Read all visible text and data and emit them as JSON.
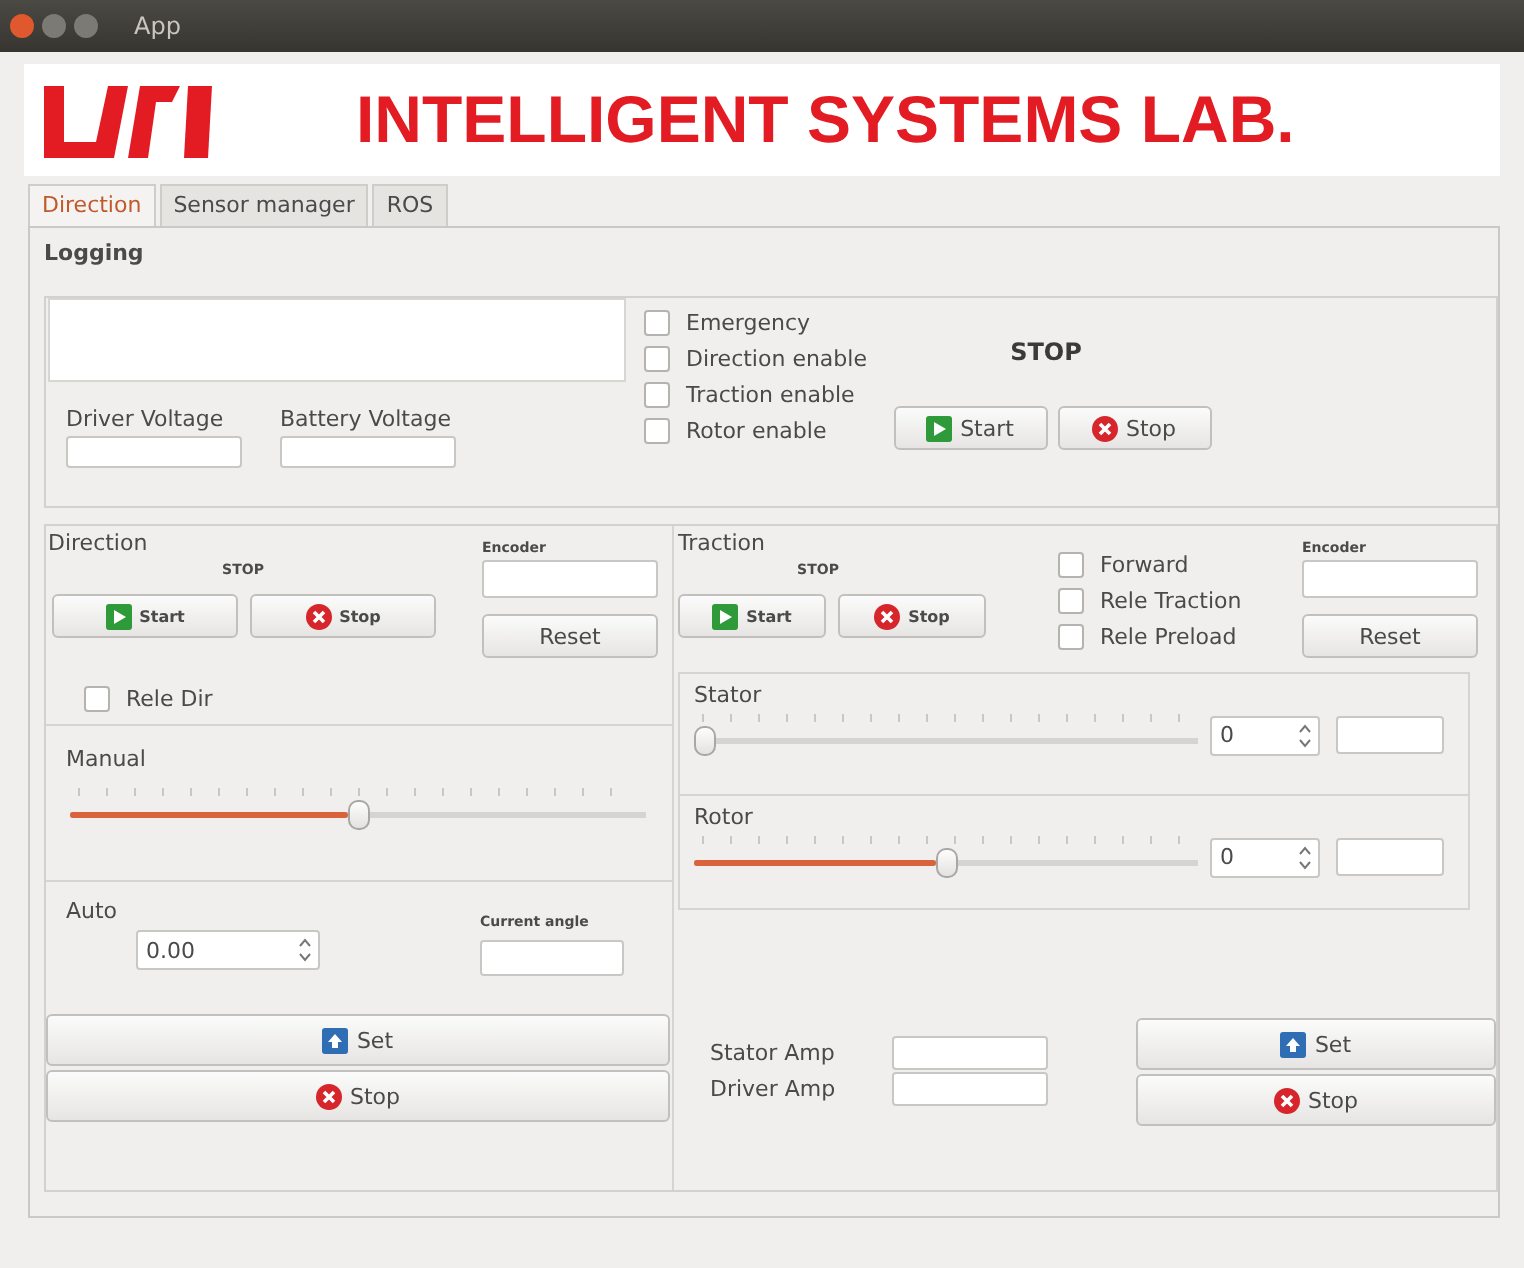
{
  "window": {
    "title": "App"
  },
  "header": {
    "title": "INTELLIGENT SYSTEMS LAB."
  },
  "tabs": [
    {
      "label": "Direction",
      "selected": true
    },
    {
      "label": "Sensor manager",
      "selected": false
    },
    {
      "label": "ROS",
      "selected": false
    }
  ],
  "logging": {
    "title": "Logging",
    "voltages": [
      {
        "label": "Driver Voltage"
      },
      {
        "label": "Battery Voltage"
      }
    ],
    "checks": [
      {
        "label": "Emergency",
        "checked": false
      },
      {
        "label": "Direction enable",
        "checked": false
      },
      {
        "label": "Traction enable",
        "checked": false
      },
      {
        "label": "Rotor enable",
        "checked": false
      }
    ],
    "status": "STOP",
    "buttons": [
      {
        "kind": "start",
        "label": "Start"
      },
      {
        "kind": "stop",
        "label": "Stop"
      }
    ]
  },
  "direction": {
    "title": "Direction",
    "status": "STOP",
    "buttons": [
      {
        "kind": "start",
        "label": "Start"
      },
      {
        "kind": "stop",
        "label": "Stop"
      }
    ],
    "encoder_label": "Encoder",
    "reset": "Reset",
    "rele_dir": {
      "label": "Rele Dir",
      "checked": false
    },
    "manual": {
      "title": "Manual",
      "level": 0.5
    },
    "auto": {
      "title": "Auto",
      "value": "0.00",
      "angle_label": "Current angle"
    },
    "actions": [
      {
        "kind": "set",
        "label": "Set"
      },
      {
        "kind": "stop",
        "label": "Stop"
      }
    ]
  },
  "traction": {
    "title": "Traction",
    "status": "STOP",
    "buttons": [
      {
        "kind": "start",
        "label": "Start"
      },
      {
        "kind": "stop",
        "label": "Stop"
      }
    ],
    "checks": [
      {
        "label": "Forward",
        "checked": false
      },
      {
        "label": "Rele Traction",
        "checked": false
      },
      {
        "label": "Rele Preload",
        "checked": false
      }
    ],
    "encoder_label": "Encoder",
    "reset": "Reset",
    "sliders": [
      {
        "label": "Stator",
        "level": 0,
        "value": "0"
      },
      {
        "label": "Rotor",
        "level": 0.5,
        "value": "0"
      }
    ],
    "amps": [
      {
        "label": "Stator Amp"
      },
      {
        "label": "Driver Amp"
      }
    ],
    "actions": [
      {
        "kind": "set",
        "label": "Set"
      },
      {
        "kind": "stop",
        "label": "Stop"
      }
    ]
  }
}
